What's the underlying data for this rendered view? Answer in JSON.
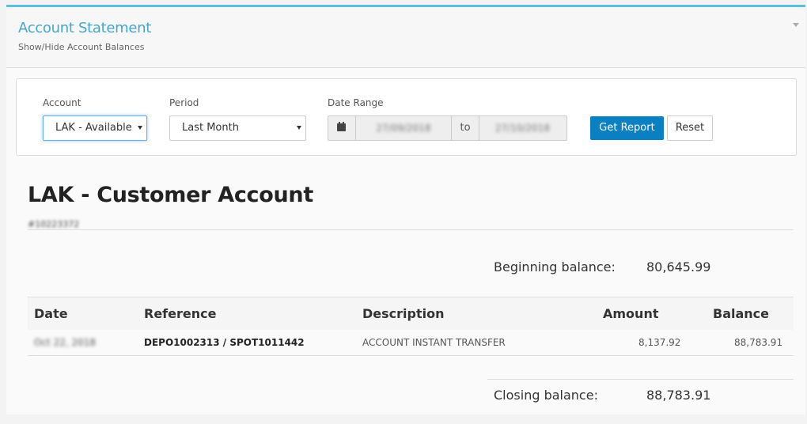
{
  "panel": {
    "title": "Account Statement",
    "subtitle": "Show/Hide Account Balances"
  },
  "filters": {
    "account_label": "Account",
    "account_value": "LAK - Available",
    "period_label": "Period",
    "period_value": "Last Month",
    "date_range_label": "Date Range",
    "date_from": "27/09/2018",
    "date_to_label": "to",
    "date_to": "27/10/2018",
    "get_report_label": "Get Report",
    "reset_label": "Reset"
  },
  "account": {
    "title": "LAK - Customer Account",
    "number": "#10223372"
  },
  "balances": {
    "beginning_label": "Beginning balance:",
    "beginning_value": "80,645.99",
    "closing_label": "Closing balance:",
    "closing_value": "88,783.91"
  },
  "table": {
    "headers": {
      "date": "Date",
      "reference": "Reference",
      "description": "Description",
      "amount": "Amount",
      "balance": "Balance"
    },
    "rows": [
      {
        "date": "Oct 22, 2018",
        "reference": "DEPO1002313 / SPOT1011442",
        "description": "ACCOUNT INSTANT TRANSFER",
        "amount": "8,137.92",
        "balance": "88,783.91"
      }
    ]
  },
  "icons": {
    "calendar": "calendar-icon",
    "collapse": "chevron-down-icon"
  },
  "colors": {
    "accent": "#5bc0de",
    "primary_button": "#0a7fc2",
    "title": "#4aa6c9"
  }
}
